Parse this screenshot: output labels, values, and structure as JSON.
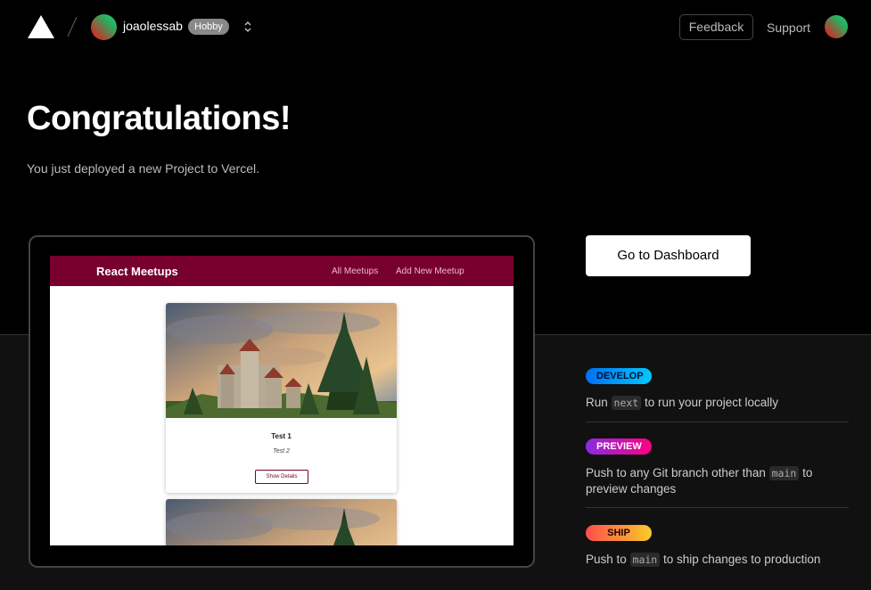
{
  "header": {
    "user_name": "joaolessab",
    "plan_badge": "Hobby",
    "feedback_label": "Feedback",
    "support_label": "Support"
  },
  "main": {
    "headline": "Congratulations!",
    "subtext": "You just deployed a new Project to Vercel.",
    "dashboard_button": "Go to Dashboard"
  },
  "preview": {
    "app_title": "React Meetups",
    "nav_all": "All Meetups",
    "nav_add": "Add New Meetup",
    "card_title": "Test 1",
    "card_subtitle": "Test 2",
    "card_button": "Show Details"
  },
  "steps": [
    {
      "badge": "DEVELOP",
      "before": "Run ",
      "code": "next",
      "after": " to run your project locally"
    },
    {
      "badge": "PREVIEW",
      "before": "Push to any Git branch other than ",
      "code": "main",
      "after": " to preview changes"
    },
    {
      "badge": "SHIP",
      "before": "Push to ",
      "code": "main",
      "after": " to ship changes to production"
    }
  ],
  "colors": {
    "app_bar": "#77002e",
    "develop_gradient": "#0070f3",
    "preview_gradient": "#8a2be2",
    "ship_gradient": "#ff4d4d"
  },
  "icons": [
    "vercel-logo-icon",
    "slash-separator-icon",
    "chevron-updown-icon"
  ]
}
